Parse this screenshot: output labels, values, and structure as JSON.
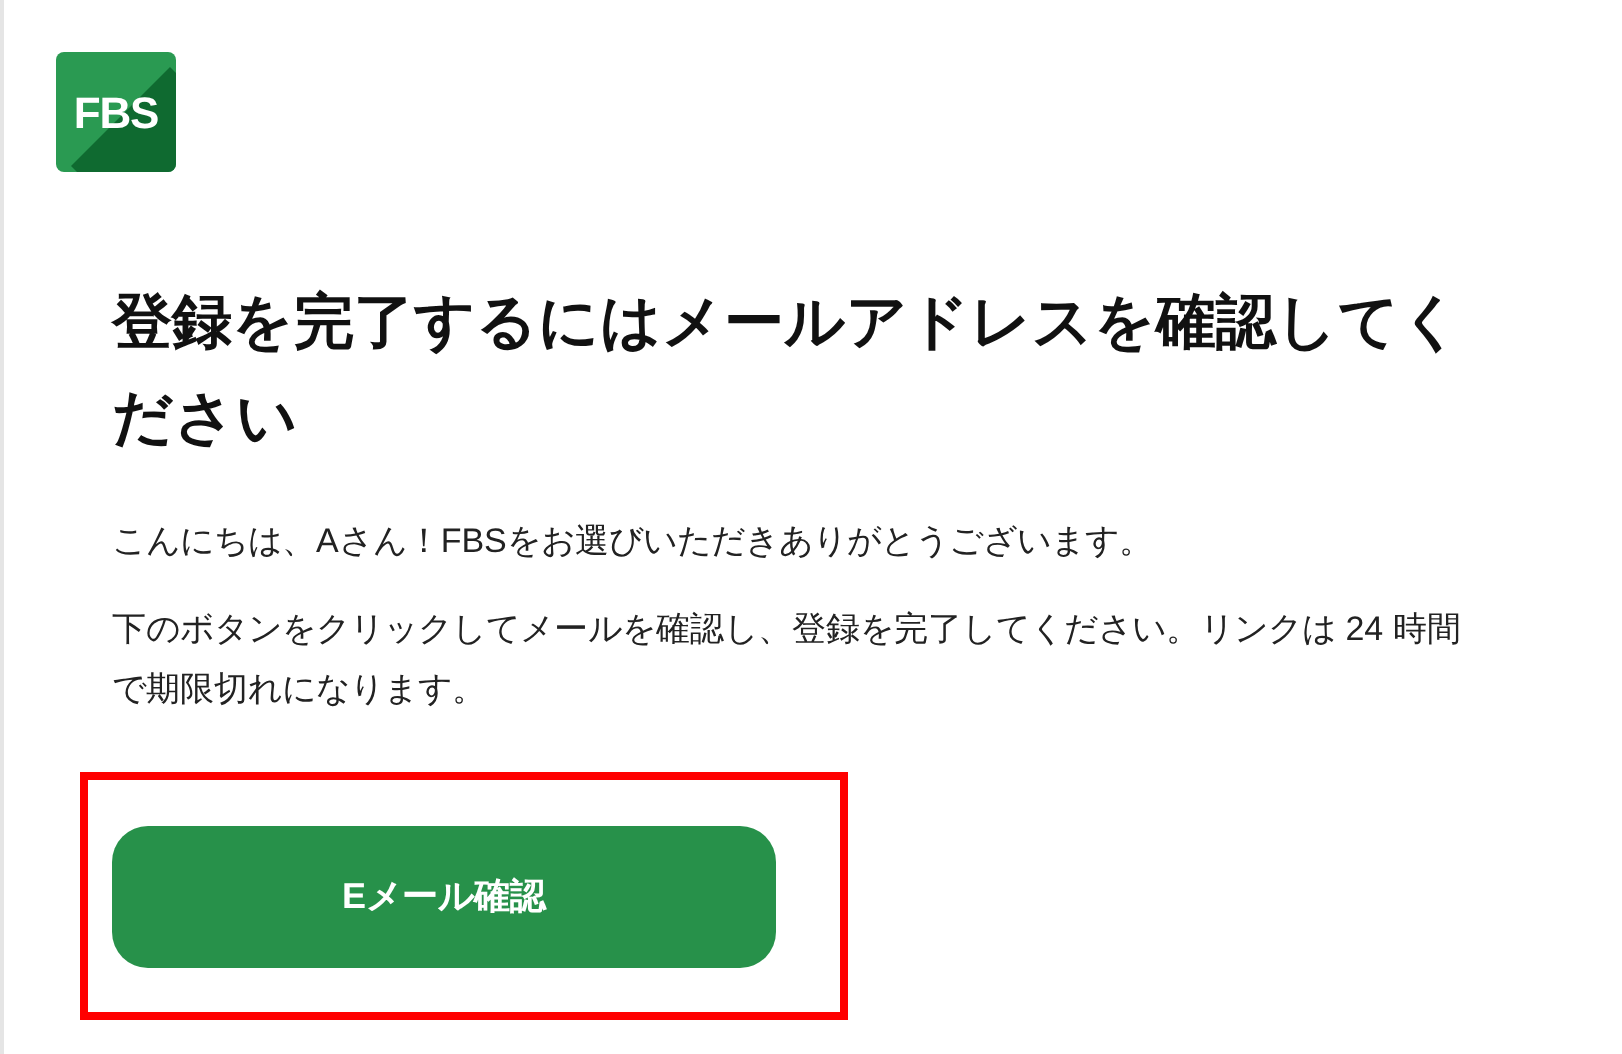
{
  "logo": {
    "text": "FBS"
  },
  "heading": "登録を完了するにはメールアドレスを確認してください",
  "paragraphs": [
    "こんにちは、Aさん！FBSをお選びいただきありがとうございます。",
    "下のボタンをクリックしてメールを確認し、登録を完了してください。リンクは 24 時間で期限切れになります。"
  ],
  "button": {
    "label": "Eメール確認",
    "highlighted": true
  }
}
